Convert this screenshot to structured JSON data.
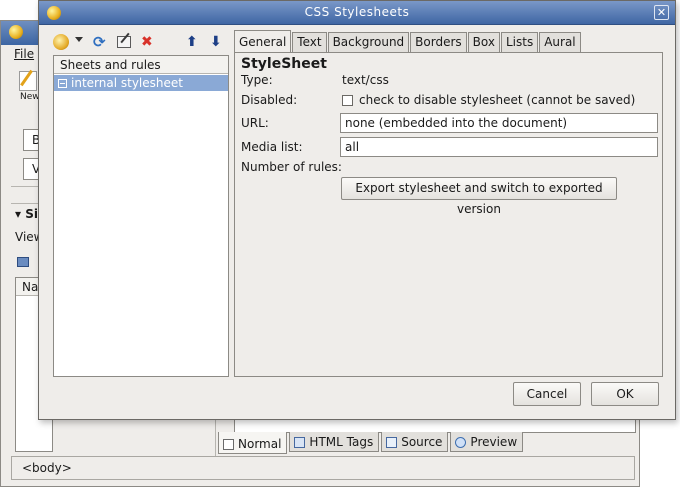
{
  "background_window": {
    "menu_file": "File",
    "new_label": "New",
    "field_b": "B",
    "field_v": "V",
    "sidebar_heading": "▾ Si",
    "view_label": "View",
    "list_header": "Nar",
    "bottom_tabs": [
      "Normal",
      "HTML Tags",
      "Source",
      "Preview"
    ],
    "status_text": "<body>"
  },
  "dialog": {
    "title": "CSS Stylesheets",
    "tree": {
      "header": "Sheets and rules",
      "items": [
        "internal stylesheet"
      ]
    },
    "tabs": [
      "General",
      "Text",
      "Background",
      "Borders",
      "Box",
      "Lists",
      "Aural"
    ],
    "general": {
      "heading": "StyleSheet",
      "type_label": "Type:",
      "type_value": "text/css",
      "disabled_label": "Disabled:",
      "disabled_checkbox_text": "check to disable stylesheet (cannot be saved)",
      "url_label": "URL:",
      "url_value": "none (embedded into the document)",
      "media_label": "Media list:",
      "media_value": "all",
      "rules_label": "Number of rules:",
      "export_button": "Export stylesheet and switch to exported version"
    },
    "buttons": {
      "cancel": "Cancel",
      "ok": "OK"
    }
  }
}
